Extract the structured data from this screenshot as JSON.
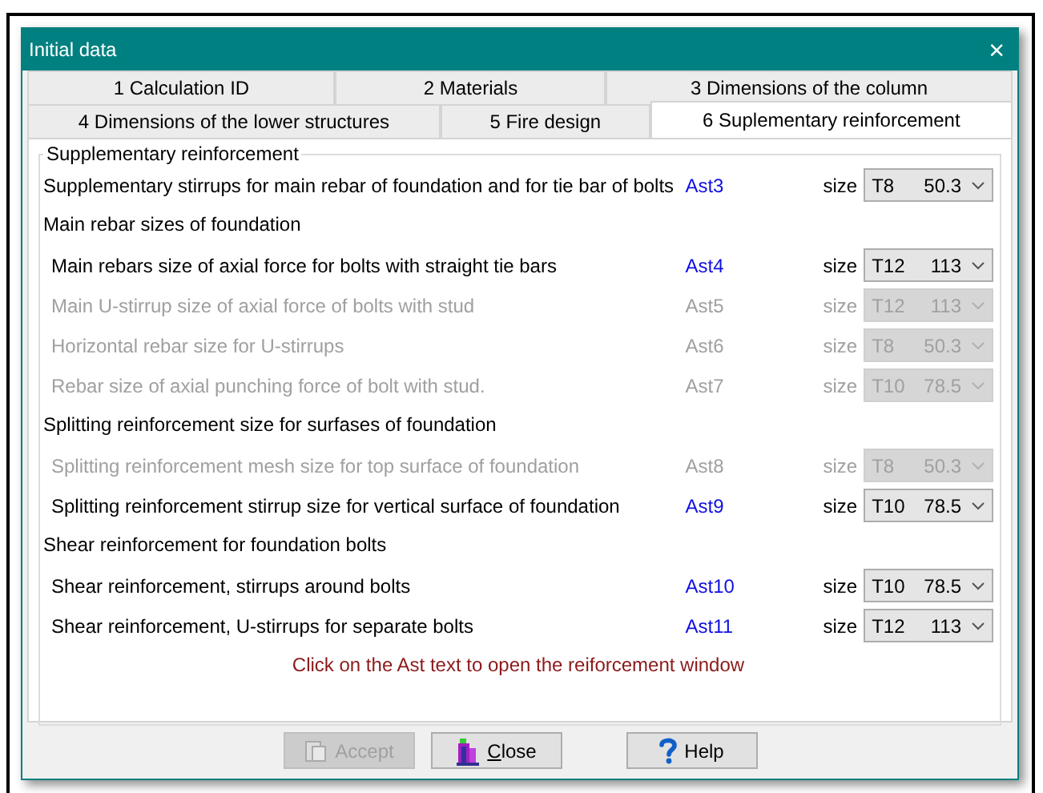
{
  "window": {
    "title": "Initial data",
    "close": "×"
  },
  "tab_rows": [
    [
      {
        "label": "1 Calculation ID",
        "selected": false
      },
      {
        "label": "2 Materials",
        "selected": false
      },
      {
        "label": "3 Dimensions of the column",
        "selected": false
      }
    ],
    [
      {
        "label": "4 Dimensions of the lower structures",
        "selected": false
      },
      {
        "label": "5 Fire design",
        "selected": false
      },
      {
        "label": "6 Suplementary reinforcement",
        "selected": true
      }
    ]
  ],
  "group_title": "Supplementary reinforcement",
  "sections": [
    {
      "rows": [
        {
          "label": "Supplementary stirrups for main rebar of foundation and for tie bar of bolts",
          "ast": "Ast3",
          "size_label": "size",
          "bar": "T8",
          "area": "50.3",
          "disabled": false,
          "indented": false
        }
      ]
    },
    {
      "heading": "Main rebar sizes of foundation",
      "rows": [
        {
          "label": "Main rebars size of axial force for bolts with straight tie bars",
          "ast": "Ast4",
          "size_label": "size",
          "bar": "T12",
          "area": "113",
          "disabled": false,
          "indented": true
        },
        {
          "label": "Main U-stirrup size of axial force of bolts with stud",
          "ast": "Ast5",
          "size_label": "size",
          "bar": "T12",
          "area": "113",
          "disabled": true,
          "indented": true
        },
        {
          "label": "Horizontal rebar size for U-stirrups",
          "ast": "Ast6",
          "size_label": "size",
          "bar": "T8",
          "area": "50.3",
          "disabled": true,
          "indented": true
        },
        {
          "label": "Rebar size of axial punching force of bolt with stud.",
          "ast": "Ast7",
          "size_label": "size",
          "bar": "T10",
          "area": "78.5",
          "disabled": true,
          "indented": true
        }
      ]
    },
    {
      "heading": "Splitting reinforcement size for surfases of foundation",
      "rows": [
        {
          "label": "Splitting reinforcement mesh size for top surface of foundation",
          "ast": "Ast8",
          "size_label": "size",
          "bar": "T8",
          "area": "50.3",
          "disabled": true,
          "indented": true
        },
        {
          "label": "Splitting reinforcement stirrup size for vertical surface of foundation",
          "ast": "Ast9",
          "size_label": "size",
          "bar": "T10",
          "area": "78.5",
          "disabled": false,
          "indented": true
        }
      ]
    },
    {
      "heading": "Shear reinforcement for foundation bolts",
      "rows": [
        {
          "label": "Shear reinforcement, stirrups around bolts",
          "ast": "Ast10",
          "size_label": "size",
          "bar": "T10",
          "area": "78.5",
          "disabled": false,
          "indented": true
        },
        {
          "label": "Shear reinforcement, U-stirrups for separate bolts",
          "ast": "Ast11",
          "size_label": "size",
          "bar": "T12",
          "area": "113",
          "disabled": false,
          "indented": true
        }
      ]
    }
  ],
  "note": "Click on the Ast text to open the reiforcement window",
  "buttons": [
    {
      "kind": "accept",
      "label": "Accept",
      "disabled": true
    },
    {
      "kind": "close",
      "label": "Close",
      "disabled": false
    },
    {
      "kind": "help",
      "label": "Help",
      "disabled": false
    }
  ]
}
